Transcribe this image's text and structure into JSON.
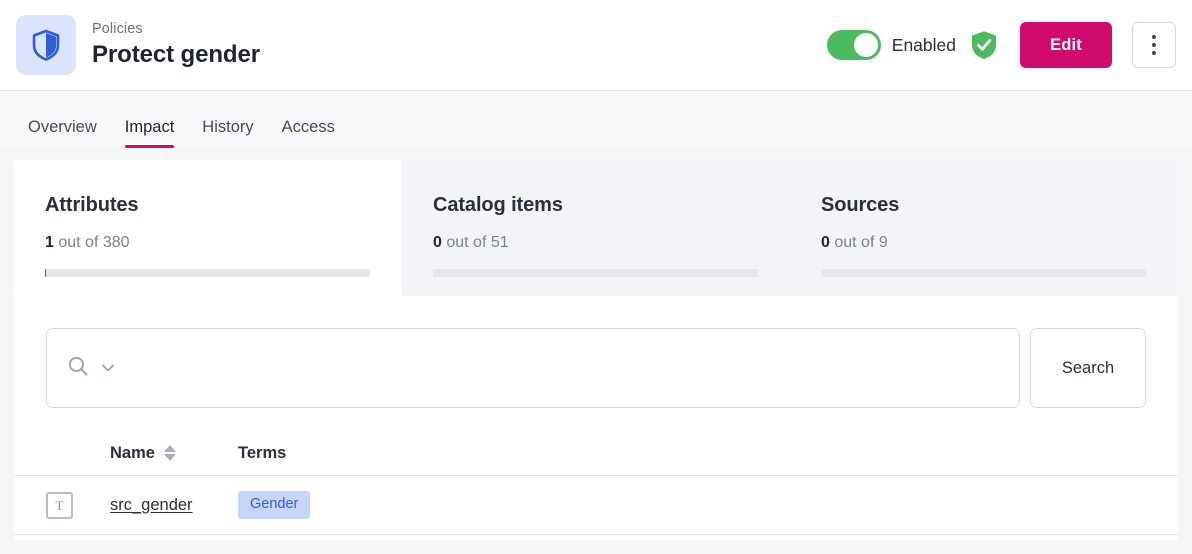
{
  "header": {
    "icon": "shield-icon",
    "breadcrumb": "Policies",
    "title": "Protect gender",
    "toggle": {
      "label": "Enabled",
      "state": "on"
    },
    "status_icon": "shield-check-icon",
    "edit_label": "Edit",
    "kebab_icon": "more-vertical-icon"
  },
  "tabs": [
    {
      "label": "Overview",
      "active": false
    },
    {
      "label": "Impact",
      "active": true
    },
    {
      "label": "History",
      "active": false
    },
    {
      "label": "Access",
      "active": false
    }
  ],
  "cards": [
    {
      "title": "Attributes",
      "value": "1",
      "rest": " out of 380",
      "progress_pct": "0.3",
      "active": true
    },
    {
      "title": "Catalog items",
      "value": "0",
      "rest": " out of 51",
      "progress_pct": "0",
      "active": false
    },
    {
      "title": "Sources",
      "value": "0",
      "rest": " out of 9",
      "progress_pct": "0",
      "active": false
    }
  ],
  "search": {
    "icon": "search-icon",
    "chevron_icon": "chevron-down-icon",
    "value": "",
    "placeholder": "",
    "button_label": "Search"
  },
  "table": {
    "columns": {
      "icon": "",
      "name": "Name",
      "terms": "Terms"
    },
    "sort_icon": "sort-arrows-icon",
    "rows": [
      {
        "type_icon": "text-type-icon",
        "type_glyph": "T",
        "name": "src_gender",
        "terms": [
          "Gender"
        ]
      }
    ]
  },
  "colors": {
    "accent": "#d10a6e",
    "toggle_on": "#4cbb5f",
    "status_ok": "#4cbb5f",
    "link_blue": "#2f5fd4",
    "badge_bg": "#c7d4fb",
    "avatar_bg": "#dce3fc"
  }
}
